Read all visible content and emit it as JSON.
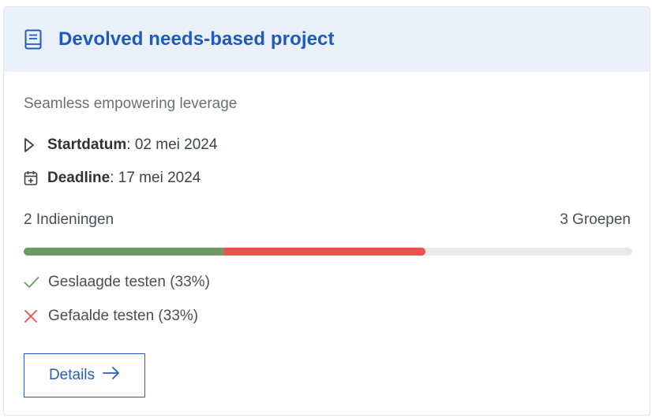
{
  "project": {
    "title": "Devolved needs-based project",
    "description": "Seamless empowering leverage",
    "header_icon": "book-icon",
    "start": {
      "label": "Startdatum",
      "value": "02 mei 2024",
      "icon": "play-triangle-icon"
    },
    "deadline": {
      "label": "Deadline",
      "value": "17 mei 2024",
      "icon": "calendar-plus-icon"
    },
    "submissions_text": "2 Indieningen",
    "groups_text": "3 Groepen",
    "progress": {
      "passed_fraction": 0.33,
      "failed_fraction": 0.33,
      "passed_color": "#6d9965",
      "failed_color": "#f1504a",
      "track_color": "#e7e7ec"
    },
    "passed_text": "Geslaagde testen (33%)",
    "failed_text": "Gefaalde testen (33%)",
    "details_label": "Details"
  },
  "colors": {
    "accent": "#1f5bbd",
    "header_bg": "#e9f0fa",
    "pass": "#6d9965",
    "fail": "#f1504a"
  }
}
